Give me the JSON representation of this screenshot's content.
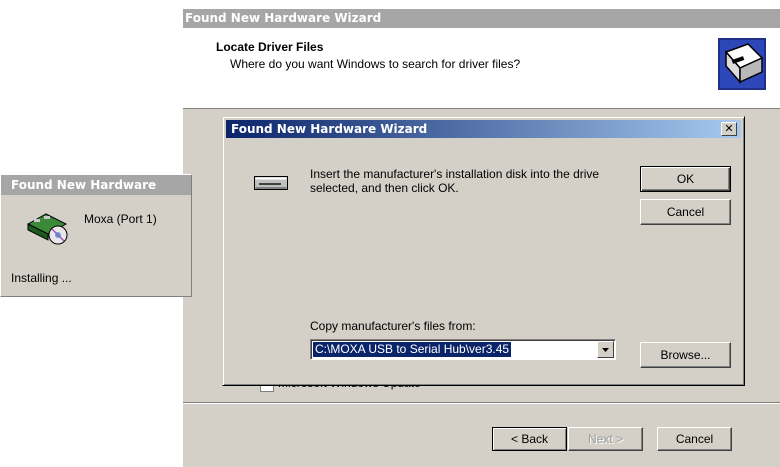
{
  "wizard": {
    "title": "Found New Hardware Wizard",
    "heading": "Locate Driver Files",
    "subheading": "Where do you want Windows to search for driver files?",
    "windows_update_label": "Microsoft Windows Update",
    "back_label": "< Back",
    "next_label": "Next >",
    "cancel_label": "Cancel"
  },
  "notification": {
    "title": "Found New Hardware",
    "device_name": "Moxa (Port 1)",
    "status": "Installing ..."
  },
  "dialog": {
    "title": "Found New Hardware Wizard",
    "close_label": "✕",
    "message": "Insert the manufacturer's installation disk into the drive selected, and then click OK.",
    "ok_label": "OK",
    "cancel_label": "Cancel",
    "copy_from_label": "Copy manufacturer's files from:",
    "copy_from_value": "C:\\MOXA USB to Serial Hub\\ver3.45",
    "browse_label": "Browse..."
  },
  "icons": [
    "wizard-hardware-icon",
    "hardware-device-icon",
    "floppy-drive-icon",
    "dropdown-arrow-icon"
  ],
  "colors": {
    "dialog_title_start": "#0a246a",
    "dialog_title_end": "#a6caf0",
    "inactive_title": "#a6a6a6",
    "face": "#d4d0c8",
    "selection": "#0a246a"
  }
}
